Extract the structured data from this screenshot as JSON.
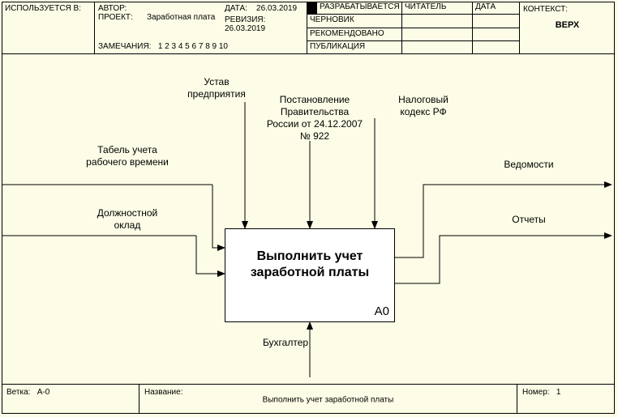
{
  "header": {
    "used_in_label": "ИСПОЛЬЗУЕТСЯ В:",
    "author_label": "АВТОР:",
    "author_value": "",
    "project_label": "ПРОЕКТ:",
    "project_value": "Заработная плата",
    "date_label": "ДАТА:",
    "date_value": "26.03.2019",
    "revision_label": "РЕВИЗИЯ:",
    "revision_value": "26.03.2019",
    "notes_label": "ЗАМЕЧАНИЯ:",
    "notes_value": "1  2  3  4  5  6  7  8  9  10",
    "status": {
      "working": "РАЗРАБАТЫВАЕТСЯ",
      "draft": "ЧЕРНОВИК",
      "recommended": "РЕКОМЕНДОВАНО",
      "publication": "ПУБЛИКАЦИЯ",
      "reader": "ЧИТАТЕЛЬ",
      "date": "ДАТА"
    },
    "context_label": "КОНТЕКСТ:",
    "context_value": "ВЕРХ"
  },
  "process": {
    "title_l1": "Выполнить учет",
    "title_l2": "заработной платы",
    "id": "A0"
  },
  "arrows": {
    "control1_l1": "Устав",
    "control1_l2": "предприятия",
    "control2_l1": "Постановление",
    "control2_l2": "Правительства",
    "control2_l3": "России  от 24.12.2007",
    "control2_l4": "№ 922",
    "control3_l1": "Налоговый",
    "control3_l2": "кодекс РФ",
    "input1_l1": "Табель учета",
    "input1_l2": "рабочего времени",
    "input2_l1": "Должностной",
    "input2_l2": "оклад",
    "output1": "Ведомости",
    "output2": "Отчеты",
    "mechanism": "Бухгалтер"
  },
  "footer": {
    "branch_label": "Ветка:",
    "branch_value": "A-0",
    "name_label": "Название:",
    "name_value": "Выполнить учет заработной платы",
    "number_label": "Номер:",
    "number_value": "1"
  }
}
